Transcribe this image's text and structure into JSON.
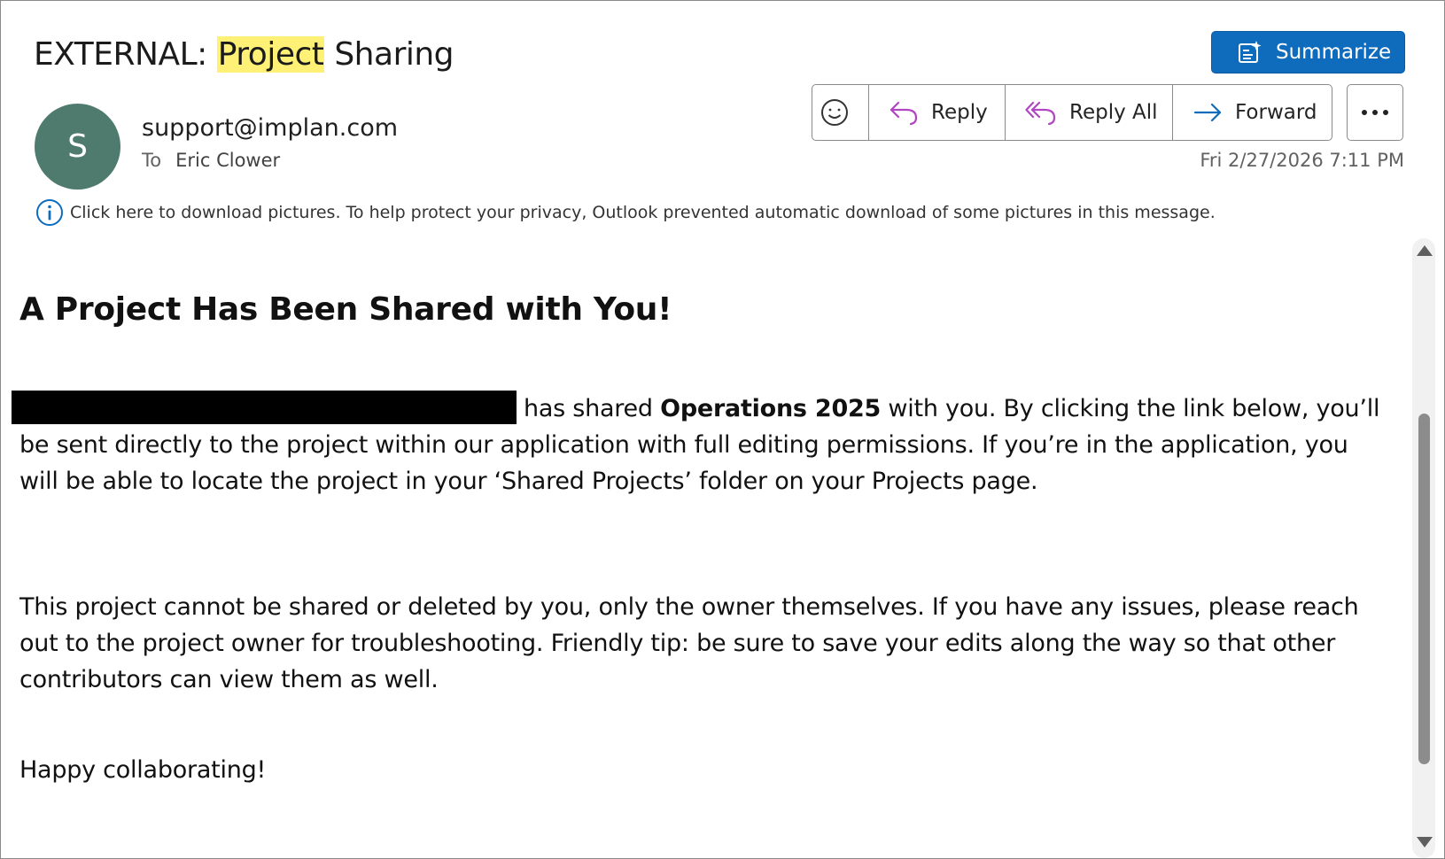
{
  "email": {
    "subject_prefix": "EXTERNAL: ",
    "subject_highlight": "Project",
    "subject_suffix": " Sharing",
    "sender": "support@implan.com",
    "avatar_initial": "S",
    "to_label": "To",
    "recipient": "Eric Clower",
    "date": "Fri 2/27/2026 7:11 PM",
    "picture_notice": "Click here to download pictures. To help protect your privacy, Outlook prevented automatic download of some pictures in this message."
  },
  "toolbar": {
    "summarize_label": "Summarize",
    "reply_label": "Reply",
    "reply_all_label": "Reply All",
    "forward_label": "Forward"
  },
  "body": {
    "heading": "A Project Has Been Shared with You!",
    "p1_before_bold": "has shared ",
    "p1_bold": "Operations 2025",
    "p1_after_bold": " with you. By clicking the link below, you’ll be sent directly to the project within our application with full editing permissions. If you’re in the application, you will be able to locate the project in your ‘Shared Projects’ folder on your Projects page.",
    "p2": "This project cannot be shared or deleted by you, only the owner themselves. If you have any issues, please reach out to the project owner for troubleshooting. Friendly tip: be sure to save your edits along the way so that other contributors can view them as well.",
    "p3": "Happy collaborating!"
  },
  "colors": {
    "accent": "#0f6cbd",
    "highlight": "#fff176",
    "avatar_bg": "#4e7b6e",
    "reply_icon": "#b146c2",
    "forward_icon": "#0f6cbd",
    "info_icon": "#0f6cbd"
  },
  "icons": [
    "sparkle-summarize-icon",
    "emoji-icon",
    "reply-arrow-icon",
    "reply-all-arrow-icon",
    "forward-arrow-icon",
    "more-dots-icon",
    "info-icon"
  ]
}
